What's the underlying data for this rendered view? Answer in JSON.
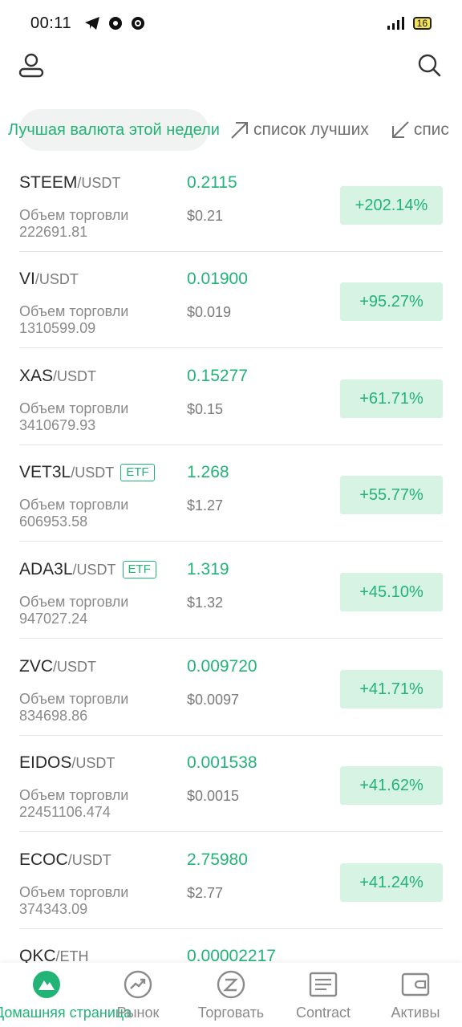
{
  "status_bar": {
    "time": "00:11",
    "battery": "16"
  },
  "tabs": {
    "active": "Лучшая валюта этой недели",
    "links": [
      "список лучших",
      "спис"
    ]
  },
  "rows": [
    {
      "base": "STEEM",
      "quote": "/USDT",
      "etf": "",
      "price": "0.2115",
      "volume_label": "Объем торговли",
      "volume": "222691.81",
      "usd": "$0.21",
      "change": "+202.14%"
    },
    {
      "base": "VI",
      "quote": "/USDT",
      "etf": "",
      "price": "0.01900",
      "volume_label": "Объем торговли",
      "volume": "1310599.09",
      "usd": "$0.019",
      "change": "+95.27%"
    },
    {
      "base": "XAS",
      "quote": "/USDT",
      "etf": "",
      "price": "0.15277",
      "volume_label": "Объем торговли",
      "volume": "3410679.93",
      "usd": "$0.15",
      "change": "+61.71%"
    },
    {
      "base": "VET3L",
      "quote": "/USDT",
      "etf": "ETF",
      "price": "1.268",
      "volume_label": "Объем торговли",
      "volume": "606953.58",
      "usd": "$1.27",
      "change": "+55.77%"
    },
    {
      "base": "ADA3L",
      "quote": "/USDT",
      "etf": "ETF",
      "price": "1.319",
      "volume_label": "Объем торговли",
      "volume": "947027.24",
      "usd": "$1.32",
      "change": "+45.10%"
    },
    {
      "base": "ZVC",
      "quote": "/USDT",
      "etf": "",
      "price": "0.009720",
      "volume_label": "Объем торговли",
      "volume": "834698.86",
      "usd": "$0.0097",
      "change": "+41.71%"
    },
    {
      "base": "EIDOS",
      "quote": "/USDT",
      "etf": "",
      "price": "0.001538",
      "volume_label": "Объем торговли",
      "volume": "22451106.474",
      "usd": "$0.0015",
      "change": "+41.62%"
    },
    {
      "base": "ECOC",
      "quote": "/USDT",
      "etf": "",
      "price": "2.75980",
      "volume_label": "Объем торговли",
      "volume": "374343.09",
      "usd": "$2.77",
      "change": "+41.24%"
    },
    {
      "base": "QKC",
      "quote": "/ETH",
      "etf": "",
      "price": "0.00002217",
      "volume_label": "",
      "volume": "",
      "usd": "",
      "change": ""
    }
  ],
  "bottom_nav": [
    {
      "label": "Домашняя страница",
      "icon": "home-mountain-icon",
      "active": true
    },
    {
      "label": "Рынок",
      "icon": "market-chart-icon",
      "active": false
    },
    {
      "label": "Торговать",
      "icon": "trade-icon",
      "active": false
    },
    {
      "label": "Contract",
      "icon": "contract-icon",
      "active": false
    },
    {
      "label": "Активы",
      "icon": "wallet-icon",
      "active": false
    }
  ],
  "colors": {
    "accent": "#22b377",
    "change_bg": "#d6f3e4"
  }
}
